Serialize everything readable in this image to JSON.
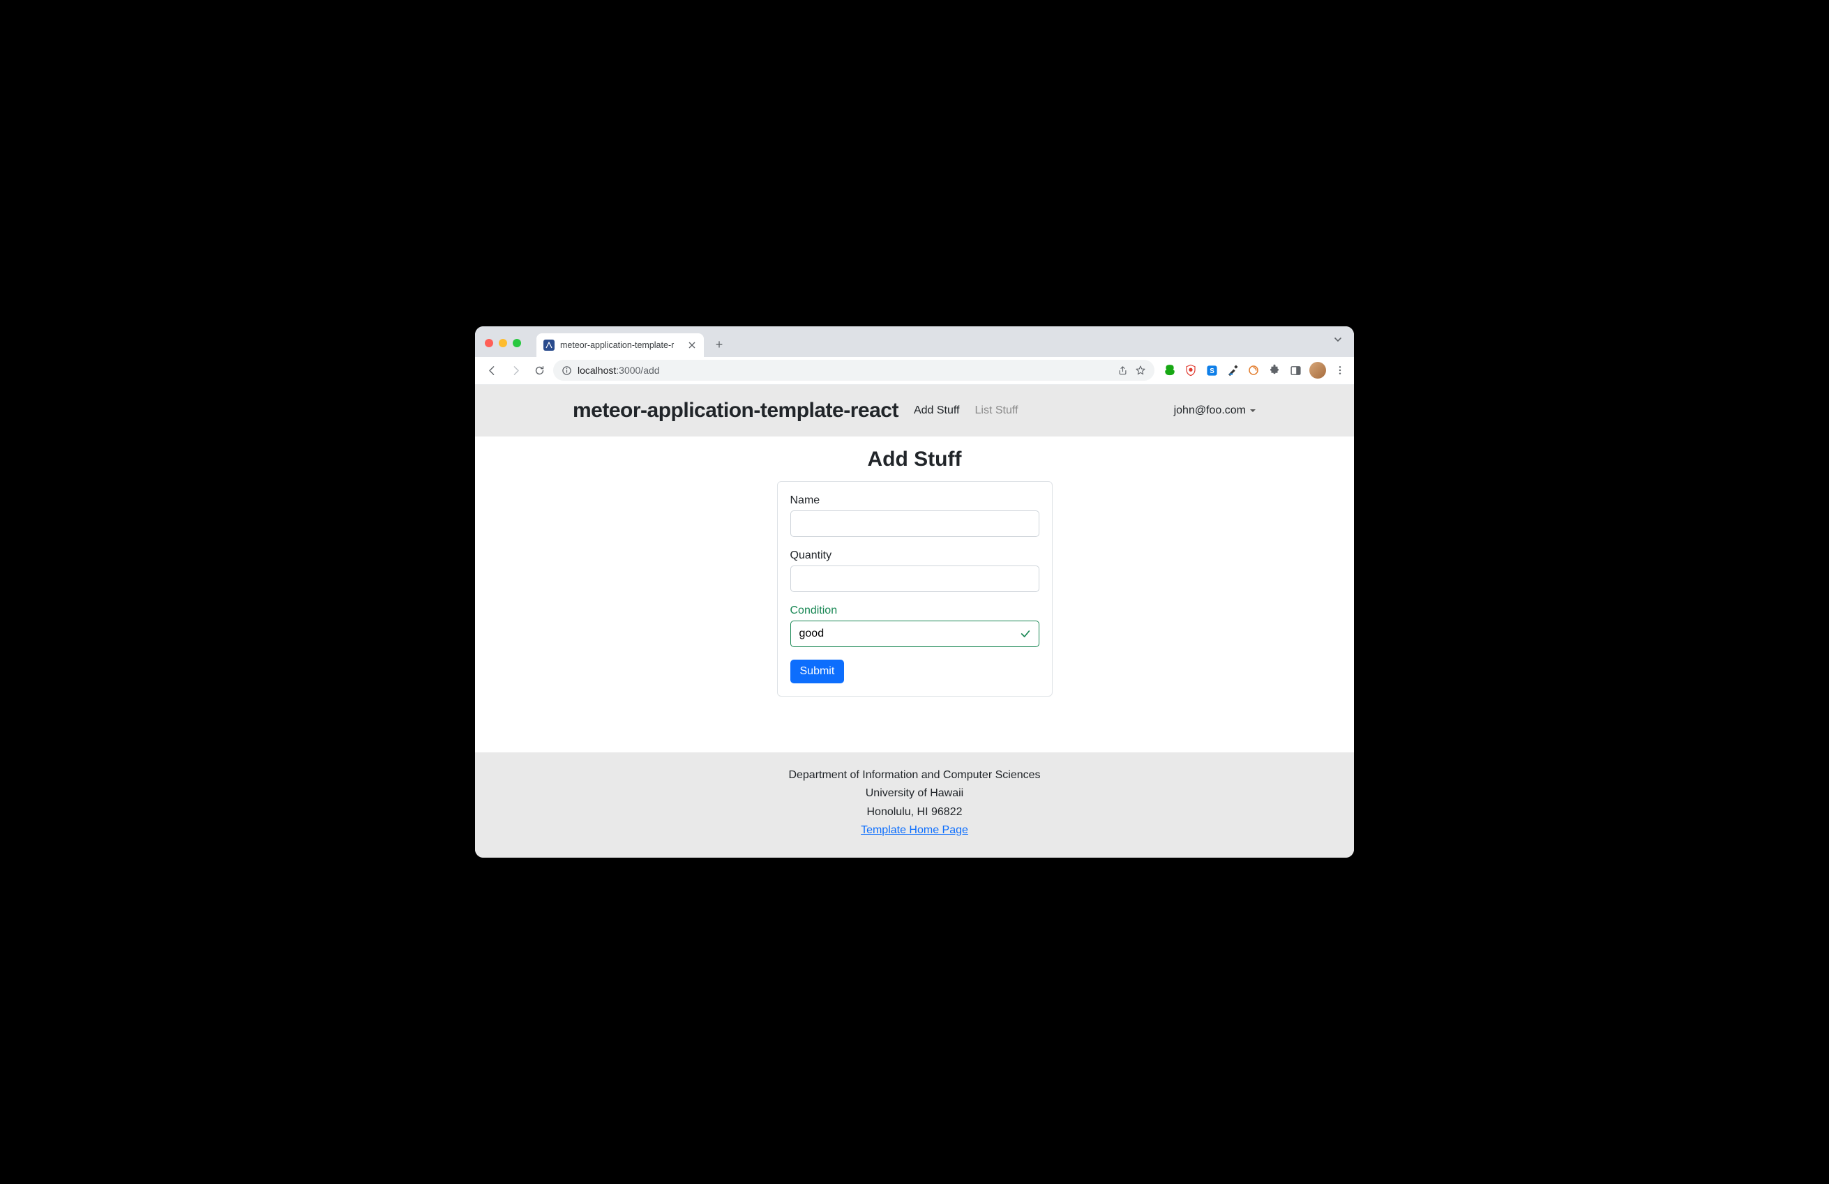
{
  "browser": {
    "tab_title": "meteor-application-template-r",
    "url_host": "localhost",
    "url_port_path": ":3000/add"
  },
  "nav": {
    "brand": "meteor-application-template-react",
    "link_add": "Add Stuff",
    "link_list": "List Stuff",
    "user_email": "john@foo.com"
  },
  "page": {
    "title": "Add Stuff"
  },
  "form": {
    "name_label": "Name",
    "name_value": "",
    "quantity_label": "Quantity",
    "quantity_value": "",
    "condition_label": "Condition",
    "condition_value": "good",
    "submit_label": "Submit"
  },
  "footer": {
    "line1": "Department of Information and Computer Sciences",
    "line2": "University of Hawaii",
    "line3": "Honolulu, HI 96822",
    "link_label": "Template Home Page"
  }
}
